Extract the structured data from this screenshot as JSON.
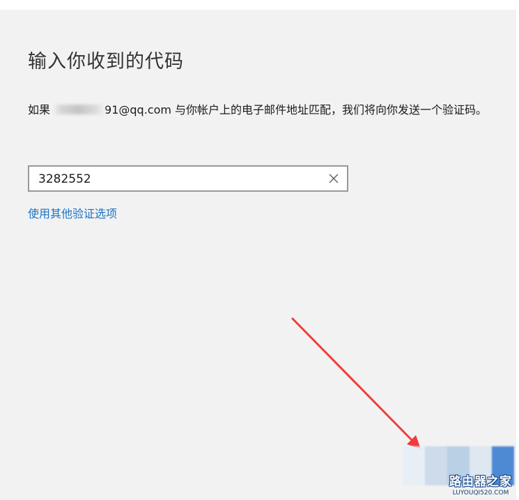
{
  "dialog": {
    "title": "输入你收到的代码",
    "description_prefix": "如果",
    "email_visible_suffix": "91@qq.com",
    "description_suffix": " 与你帐户上的电子邮件地址匹配，我们将向你发送一个验证码。",
    "code_value": "3282552",
    "clear_icon": "close-icon",
    "other_options_link": "使用其他验证选项"
  },
  "annotation": {
    "arrow_color": "#f03c3c"
  },
  "watermark": {
    "name": "路由器之家",
    "domain": "LUYOUQI520.COM"
  },
  "colors": {
    "background": "#f2f2f2",
    "link": "#1a73c6",
    "input_border": "#999999"
  }
}
